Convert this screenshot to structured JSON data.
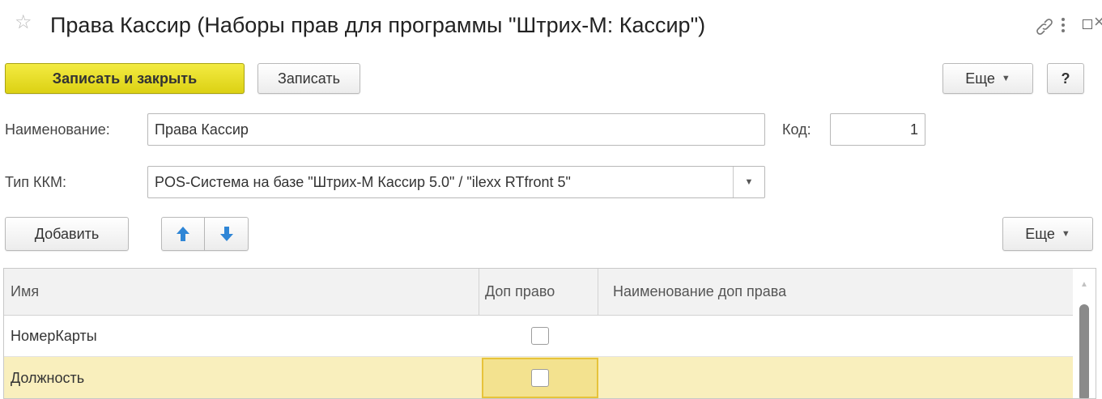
{
  "window": {
    "title": "Права Кассир (Наборы прав для программы \"Штрих-М: Кассир\")",
    "star_icon": "star-icon",
    "link_icon": "link-icon",
    "more_icon": "more-vertical-icon",
    "maximize_icon": "maximize-icon",
    "close_glyph": "×"
  },
  "toolbar": {
    "save_close_label": "Записать и закрыть",
    "save_label": "Записать",
    "more_label": "Еще",
    "help_label": "?"
  },
  "form": {
    "name_label": "Наименование:",
    "name_value": "Права Кассир",
    "code_label": "Код:",
    "code_value": "1",
    "kkm_label": "Тип ККМ:",
    "kkm_value": "POS-Система на базе \"Штрих-М Кассир 5.0\" / \"ilexx RTfront 5\""
  },
  "table_toolbar": {
    "add_label": "Добавить",
    "more_label": "Еще"
  },
  "table": {
    "columns": [
      "Имя",
      "Доп право",
      "Наименование доп права"
    ],
    "rows": [
      {
        "name": "НомерКарты",
        "extra_right": false,
        "extra_name": ""
      },
      {
        "name": "Должность",
        "extra_right": false,
        "extra_name": ""
      }
    ],
    "selected_row": 1
  },
  "colors": {
    "accent": "#e8dd2a",
    "selection": "#f9efbd",
    "arrow_blue": "#2f86d6"
  }
}
